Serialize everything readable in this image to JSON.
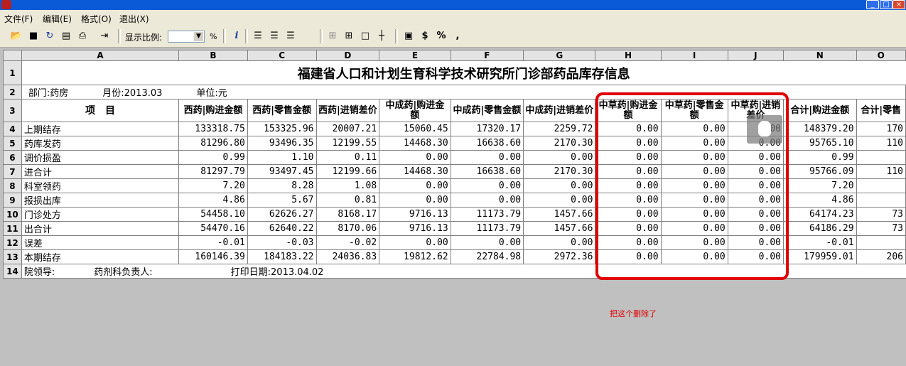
{
  "menu": [
    "文件(F)",
    "编辑(E)",
    "格式(O)",
    "退出(X)"
  ],
  "toolbar": {
    "zoom_label": "显示比例:",
    "zoom_value": "",
    "percent": "%",
    "icons": [
      "open-icon",
      "save-icon",
      "refresh-icon",
      "export-icon",
      "print-icon",
      "exit-icon",
      "info-icon",
      "align-left-icon",
      "align-center-icon",
      "align-right-icon",
      "border-none-icon",
      "border-all-icon",
      "border-outer-icon",
      "border-inner-icon",
      "format-icon",
      "currency-icon",
      "percent-icon",
      "thousands-icon"
    ],
    "glyphs": {
      "currency": "$",
      "percent": "%",
      "comma": ",",
      "info": "i"
    }
  },
  "columns": [
    "A",
    "B",
    "C",
    "D",
    "E",
    "F",
    "G",
    "H",
    "I",
    "J",
    "N",
    "O"
  ],
  "row_numbers": [
    "1",
    "2",
    "3",
    "4",
    "5",
    "6",
    "7",
    "8",
    "9",
    "10",
    "11",
    "12",
    "13",
    "14"
  ],
  "title": "福建省人口和计划生育科学技术研究所门诊部药品库存信息",
  "info": {
    "dept": "部门:药房",
    "month": "月份:2013.03",
    "unit": "单位:元"
  },
  "headers": [
    "项　目",
    "西药|购进金额",
    "西药|零售金额",
    "西药|进销差价",
    "中成药|购进金额",
    "中成药|零售金额",
    "中成药|进销差价",
    "中草药|购进金额",
    "中草药|零售金额",
    "中草药|进销差价",
    "合计|购进金额",
    "合计|零售"
  ],
  "rows": [
    {
      "label": "上期结存",
      "values": [
        "133318.75",
        "153325.96",
        "20007.21",
        "15060.45",
        "17320.17",
        "2259.72",
        "0.00",
        "0.00",
        "0.00",
        "148379.20",
        "170"
      ]
    },
    {
      "label": "药库发药",
      "values": [
        "81296.80",
        "93496.35",
        "12199.55",
        "14468.30",
        "16638.60",
        "2170.30",
        "0.00",
        "0.00",
        "0.00",
        "95765.10",
        "110"
      ]
    },
    {
      "label": "调价损盈",
      "values": [
        "0.99",
        "1.10",
        "0.11",
        "0.00",
        "0.00",
        "0.00",
        "0.00",
        "0.00",
        "0.00",
        "0.99",
        ""
      ]
    },
    {
      "label": "进合计",
      "values": [
        "81297.79",
        "93497.45",
        "12199.66",
        "14468.30",
        "16638.60",
        "2170.30",
        "0.00",
        "0.00",
        "0.00",
        "95766.09",
        "110"
      ]
    },
    {
      "label": "科室领药",
      "values": [
        "7.20",
        "8.28",
        "1.08",
        "0.00",
        "0.00",
        "0.00",
        "0.00",
        "0.00",
        "0.00",
        "7.20",
        ""
      ]
    },
    {
      "label": "报损出库",
      "values": [
        "4.86",
        "5.67",
        "0.81",
        "0.00",
        "0.00",
        "0.00",
        "0.00",
        "0.00",
        "0.00",
        "4.86",
        ""
      ]
    },
    {
      "label": "门诊处方",
      "values": [
        "54458.10",
        "62626.27",
        "8168.17",
        "9716.13",
        "11173.79",
        "1457.66",
        "0.00",
        "0.00",
        "0.00",
        "64174.23",
        "73"
      ]
    },
    {
      "label": "出合计",
      "values": [
        "54470.16",
        "62640.22",
        "8170.06",
        "9716.13",
        "11173.79",
        "1457.66",
        "0.00",
        "0.00",
        "0.00",
        "64186.29",
        "73"
      ]
    },
    {
      "label": "误差",
      "values": [
        "-0.01",
        "-0.03",
        "-0.02",
        "0.00",
        "0.00",
        "0.00",
        "0.00",
        "0.00",
        "0.00",
        "-0.01",
        ""
      ]
    },
    {
      "label": "本期结存",
      "values": [
        "160146.39",
        "184183.22",
        "24036.83",
        "19812.62",
        "22784.98",
        "2972.36",
        "0.00",
        "0.00",
        "0.00",
        "179959.01",
        "206"
      ]
    }
  ],
  "footer": {
    "leader": "院领导:",
    "pharmacy_head": "药剂科负责人:",
    "print_date": "打印日期:2013.04.02"
  },
  "annotation": "把这个删除了",
  "colors": {
    "annotation": "#e00000",
    "titlebar": "#0a5ad8"
  }
}
